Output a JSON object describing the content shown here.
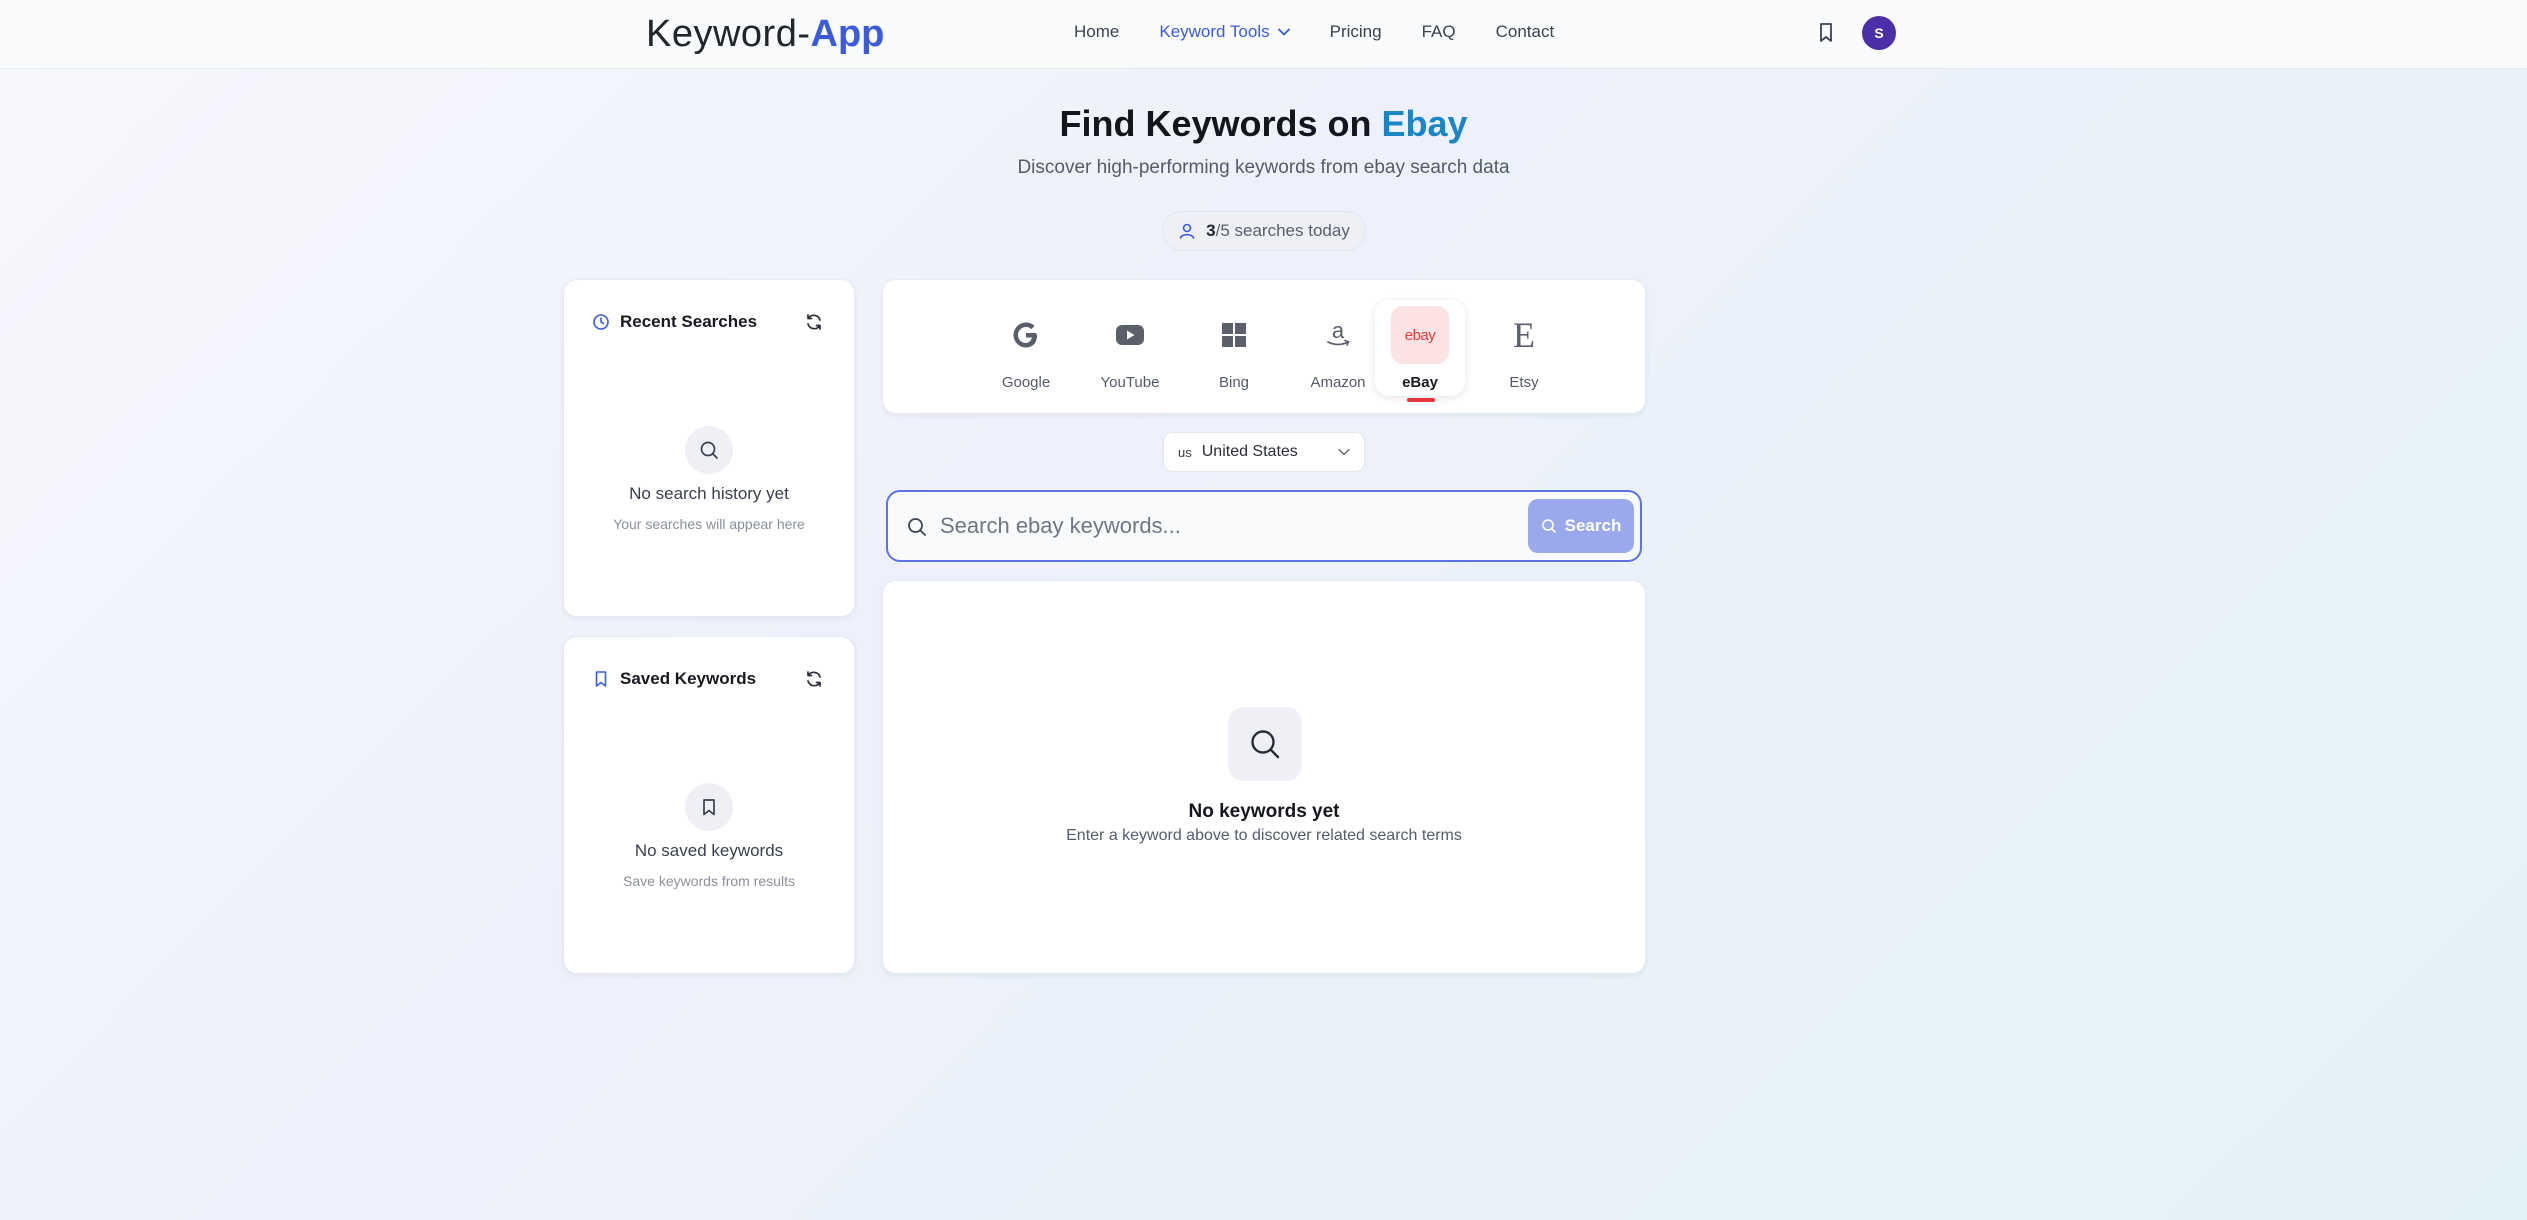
{
  "nav": {
    "logo_part1": "Keyword-",
    "logo_part2": "App",
    "links": [
      "Home",
      "Keyword Tools",
      "Pricing",
      "FAQ",
      "Contact"
    ],
    "active_link": "Keyword Tools",
    "avatar_initial": "S"
  },
  "hero": {
    "title_prefix": "Find Keywords on ",
    "title_accent": "Ebay",
    "subtitle": "Discover high-performing keywords from ebay search data"
  },
  "quota": {
    "used": "3",
    "rest": "/5 searches today"
  },
  "recent": {
    "title": "Recent Searches",
    "empty_title": "No search history yet",
    "empty_sub": "Your searches will appear here"
  },
  "saved": {
    "title": "Saved Keywords",
    "empty_title": "No saved keywords",
    "empty_sub": "Save keywords from results"
  },
  "engines": [
    {
      "label": "Google",
      "icon": "google-icon"
    },
    {
      "label": "YouTube",
      "icon": "youtube-icon"
    },
    {
      "label": "Bing",
      "icon": "bing-icon"
    },
    {
      "label": "Amazon",
      "icon": "amazon-icon"
    },
    {
      "label": "eBay",
      "icon": "ebay-icon",
      "icon_text": "ebay",
      "selected": true
    },
    {
      "label": "Etsy",
      "icon": "etsy-icon",
      "icon_text": "E"
    }
  ],
  "country": {
    "code": "us",
    "name": "United States"
  },
  "search": {
    "placeholder": "Search ebay keywords...",
    "button_label": "Search"
  },
  "results": {
    "empty_title": "No keywords yet",
    "empty_sub": "Enter a keyword above to discover related search terms"
  },
  "colors": {
    "accent": "#3b5bdb",
    "ebay_accent": "#1a86c7",
    "selected_bar": "#e5383b",
    "avatar": "#4b2fa6"
  }
}
